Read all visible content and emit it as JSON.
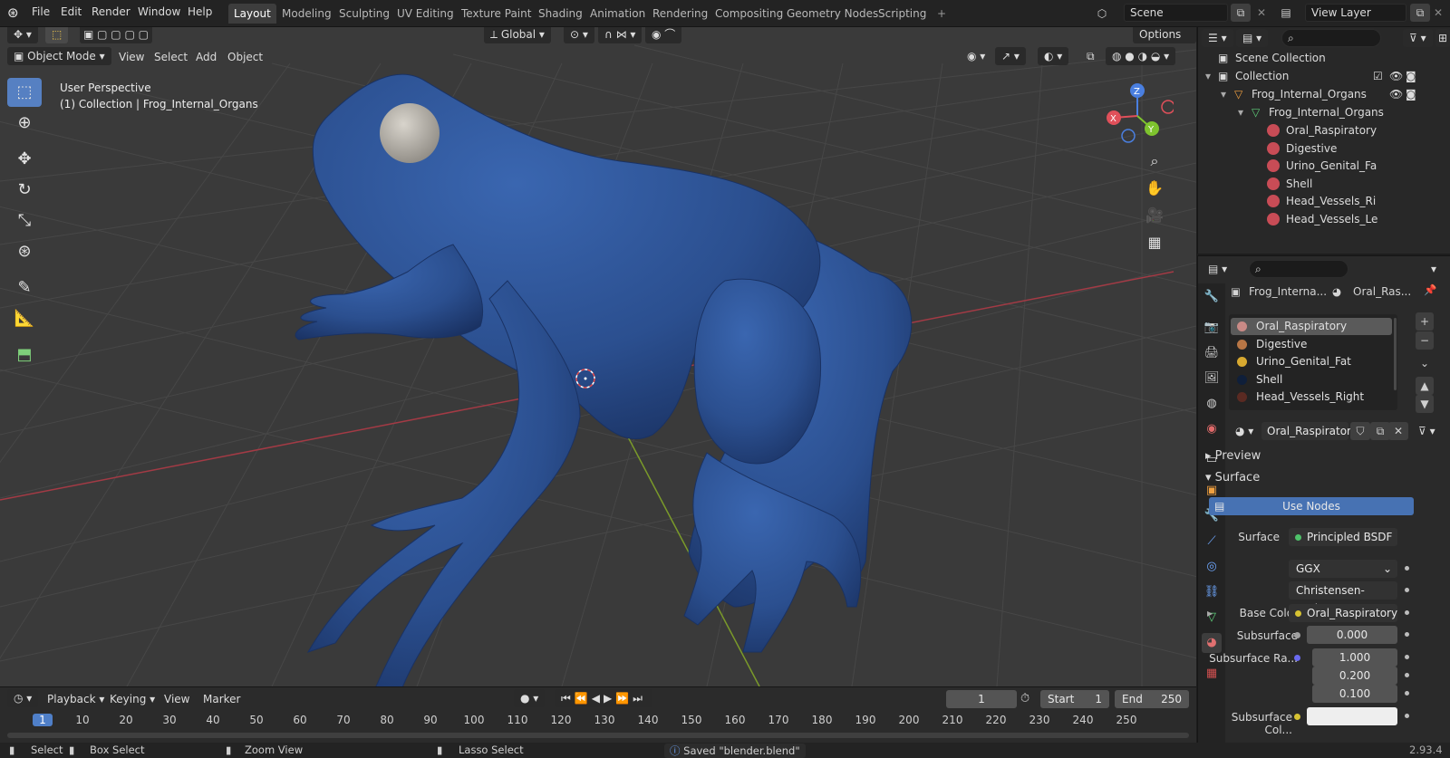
{
  "topbar": {
    "menus": [
      "File",
      "Edit",
      "Render",
      "Window",
      "Help"
    ],
    "workspaces": [
      "Layout",
      "Modeling",
      "Sculpting",
      "UV Editing",
      "Texture Paint",
      "Shading",
      "Animation",
      "Rendering",
      "Compositing",
      "Geometry Nodes",
      "Scripting"
    ],
    "active_workspace": "Layout",
    "add_workspace": "+",
    "scene": "Scene",
    "view_layer": "View Layer"
  },
  "viewport": {
    "mode": "Object Mode",
    "menus": [
      "View",
      "Select",
      "Add",
      "Object"
    ],
    "transform_orientation": "Global",
    "options_label": "Options",
    "perspective_label": "User Perspective",
    "context_label": "(1) Collection | Frog_Internal_Organs",
    "gizmo": {
      "x": "X",
      "y": "Y",
      "z": "Z"
    },
    "colors": {
      "mesh": "#2b4f8f",
      "background": "#3a3a3a",
      "grid": "#474747",
      "x_axis": "#a33a45",
      "y_axis": "#7a9a2a"
    }
  },
  "timeline": {
    "menus": [
      "Playback",
      "Keying",
      "View",
      "Marker"
    ],
    "current_frame": "1",
    "start_label": "Start",
    "start": "1",
    "end_label": "End",
    "end": "250",
    "frames": [
      "1",
      "10",
      "20",
      "30",
      "40",
      "50",
      "60",
      "70",
      "80",
      "90",
      "100",
      "110",
      "120",
      "130",
      "140",
      "150",
      "160",
      "170",
      "180",
      "190",
      "200",
      "210",
      "220",
      "230",
      "240",
      "250"
    ]
  },
  "statusbar": {
    "select": "Select",
    "box_select": "Box Select",
    "zoom_view": "Zoom View",
    "lasso_select": "Lasso Select",
    "message": "Saved \"blender.blend\"",
    "version": "2.93.4"
  },
  "outliner": {
    "scene_collection": "Scene Collection",
    "collection": "Collection",
    "object": "Frog_Internal_Organs",
    "mesh": "Frog_Internal_Organs",
    "materials": [
      "Oral_Raspiratory",
      "Digestive",
      "Urino_Genital_Fa",
      "Shell",
      "Head_Vessels_Ri",
      "Head_Vessels_Le"
    ]
  },
  "properties": {
    "breadcrumb_object": "Frog_Interna...",
    "breadcrumb_material": "Oral_Ras...",
    "material_slots": [
      {
        "name": "Oral_Raspiratory",
        "color": "#c98a86"
      },
      {
        "name": "Digestive",
        "color": "#b87645"
      },
      {
        "name": "Urino_Genital_Fat",
        "color": "#d8a930"
      },
      {
        "name": "Shell",
        "color": "#0f1f3a"
      },
      {
        "name": "Head_Vessels_Right",
        "color": "#5a2a22"
      }
    ],
    "active_material": "Oral_Raspiratory",
    "preview_label": "Preview",
    "surface_section": "Surface",
    "use_nodes": "Use Nodes",
    "surface_label": "Surface",
    "surface_value": "Principled BSDF",
    "distribution": "GGX",
    "subsurface_method": "Christensen-Burley",
    "base_color_label": "Base Color",
    "base_color_value": "Oral_Raspiratory_...",
    "subsurface_label": "Subsurface",
    "subsurface_value": "0.000",
    "subsurface_radius_label": "Subsurface Ra...",
    "subsurface_radius": [
      "1.000",
      "0.200",
      "0.100"
    ],
    "subsurface_color_label": "Subsurface Col..."
  }
}
